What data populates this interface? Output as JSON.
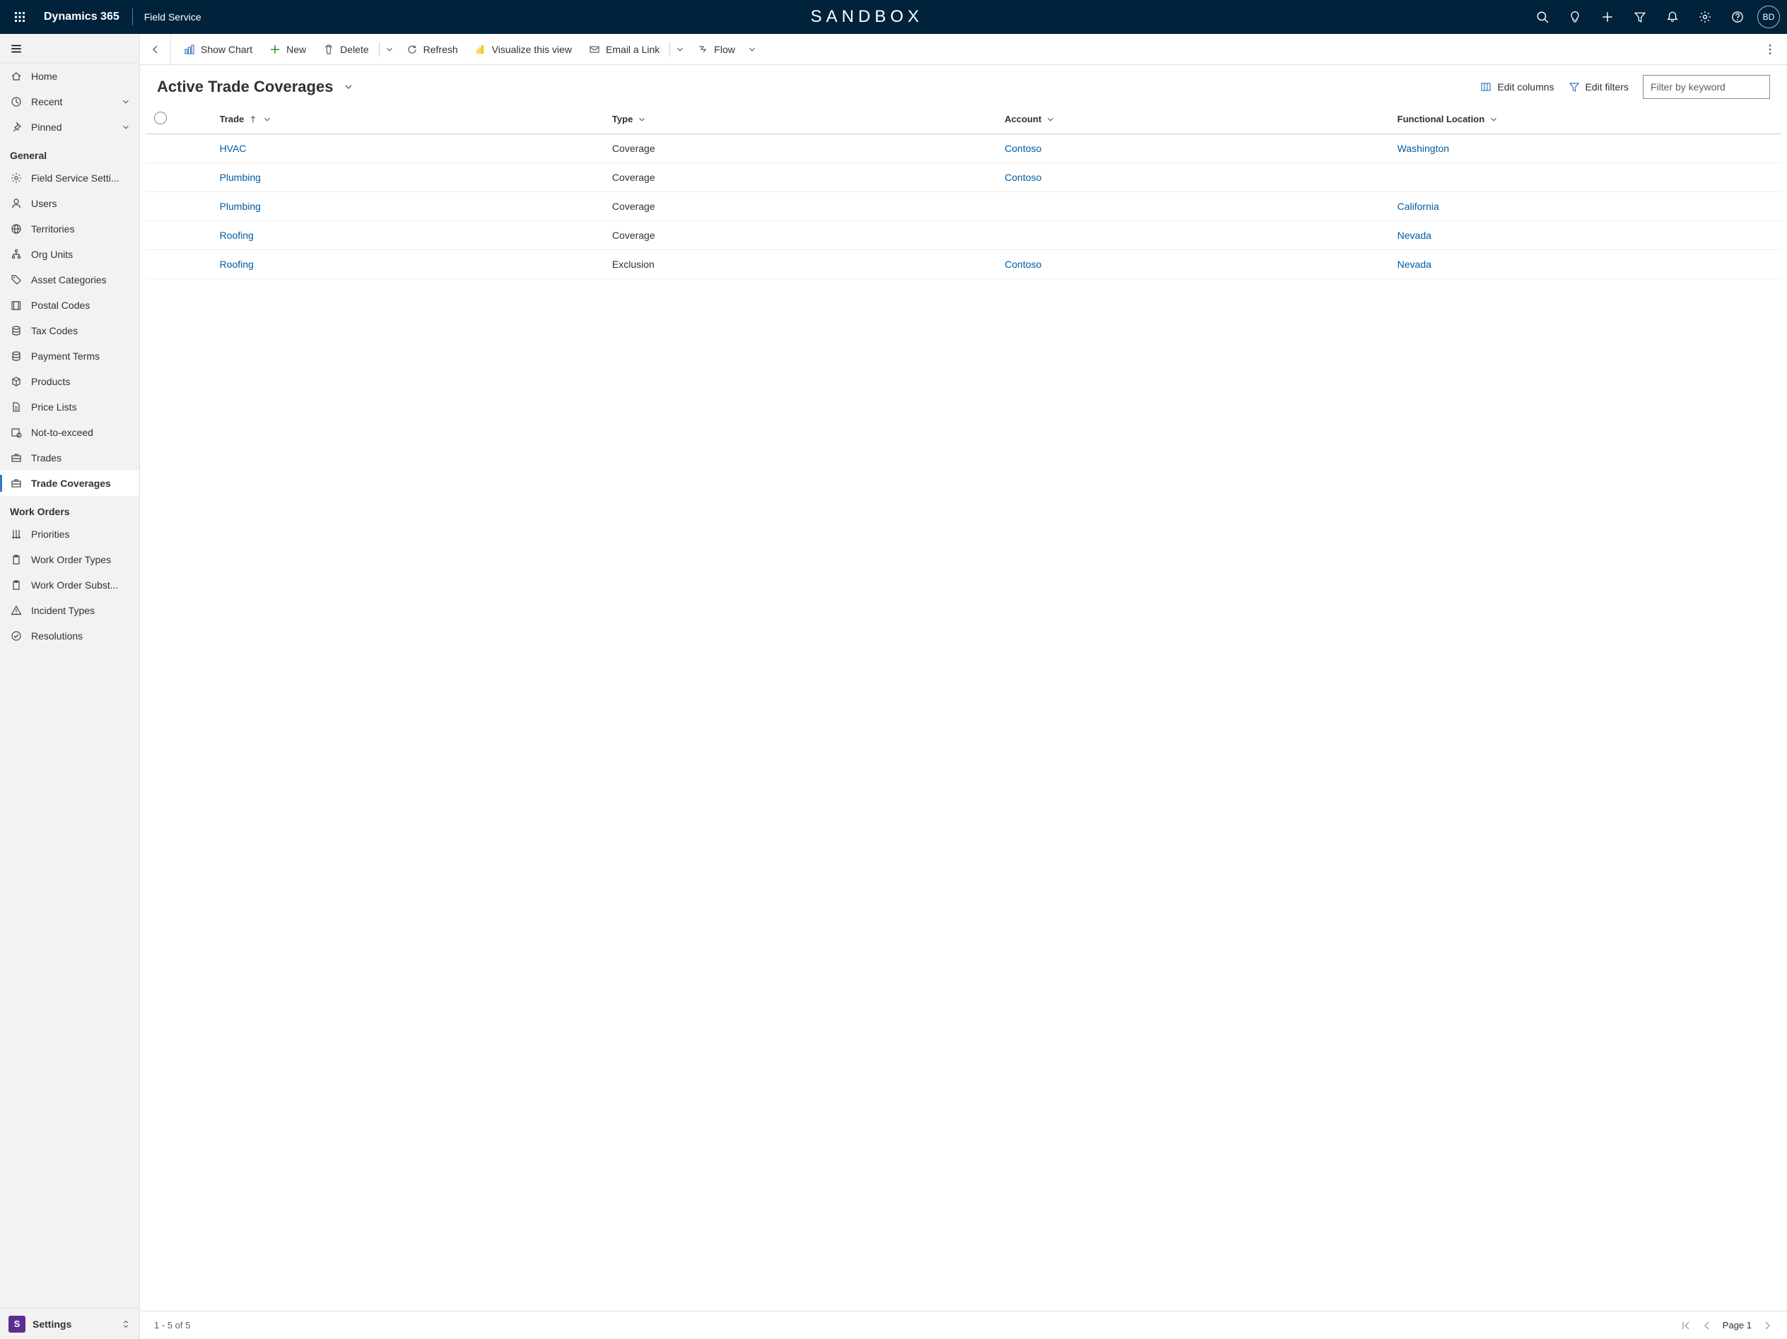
{
  "topbar": {
    "brand": "Dynamics 365",
    "app": "Field Service",
    "center_label": "SANDBOX",
    "avatar_initials": "BD"
  },
  "sidebar": {
    "main": [
      {
        "label": "Home",
        "icon": "home"
      },
      {
        "label": "Recent",
        "icon": "clock",
        "expandable": true
      },
      {
        "label": "Pinned",
        "icon": "pin",
        "expandable": true
      }
    ],
    "sections": [
      {
        "title": "General",
        "items": [
          {
            "label": "Field Service Setti...",
            "icon": "gear"
          },
          {
            "label": "Users",
            "icon": "person"
          },
          {
            "label": "Territories",
            "icon": "globe"
          },
          {
            "label": "Org Units",
            "icon": "org"
          },
          {
            "label": "Asset Categories",
            "icon": "tag"
          },
          {
            "label": "Postal Codes",
            "icon": "postal"
          },
          {
            "label": "Tax Codes",
            "icon": "db"
          },
          {
            "label": "Payment Terms",
            "icon": "db"
          },
          {
            "label": "Products",
            "icon": "cube"
          },
          {
            "label": "Price Lists",
            "icon": "doc"
          },
          {
            "label": "Not-to-exceed",
            "icon": "nte"
          },
          {
            "label": "Trades",
            "icon": "briefcase"
          },
          {
            "label": "Trade Coverages",
            "icon": "briefcase",
            "active": true
          }
        ]
      },
      {
        "title": "Work Orders",
        "items": [
          {
            "label": "Priorities",
            "icon": "priority"
          },
          {
            "label": "Work Order Types",
            "icon": "clip"
          },
          {
            "label": "Work Order Subst...",
            "icon": "clip"
          },
          {
            "label": "Incident Types",
            "icon": "warn"
          },
          {
            "label": "Resolutions",
            "icon": "check"
          }
        ]
      }
    ],
    "area": {
      "label": "Settings",
      "initial": "S"
    }
  },
  "cmdbar": {
    "show_chart": "Show Chart",
    "new": "New",
    "delete": "Delete",
    "refresh": "Refresh",
    "visualize": "Visualize this view",
    "email_link": "Email a Link",
    "flow": "Flow"
  },
  "view": {
    "title": "Active Trade Coverages",
    "edit_columns": "Edit columns",
    "edit_filters": "Edit filters",
    "filter_placeholder": "Filter by keyword"
  },
  "grid": {
    "columns": [
      {
        "label": "Trade",
        "sorted": "asc"
      },
      {
        "label": "Type"
      },
      {
        "label": "Account"
      },
      {
        "label": "Functional Location"
      }
    ],
    "rows": [
      {
        "trade": "HVAC",
        "type": "Coverage",
        "account": "Contoso",
        "func": "Washington"
      },
      {
        "trade": "Plumbing",
        "type": "Coverage",
        "account": "Contoso",
        "func": ""
      },
      {
        "trade": "Plumbing",
        "type": "Coverage",
        "account": "",
        "func": "California"
      },
      {
        "trade": "Roofing",
        "type": "Coverage",
        "account": "",
        "func": "Nevada"
      },
      {
        "trade": "Roofing",
        "type": "Exclusion",
        "account": "Contoso",
        "func": "Nevada"
      }
    ]
  },
  "footer": {
    "range": "1 - 5 of 5",
    "page": "Page 1"
  }
}
